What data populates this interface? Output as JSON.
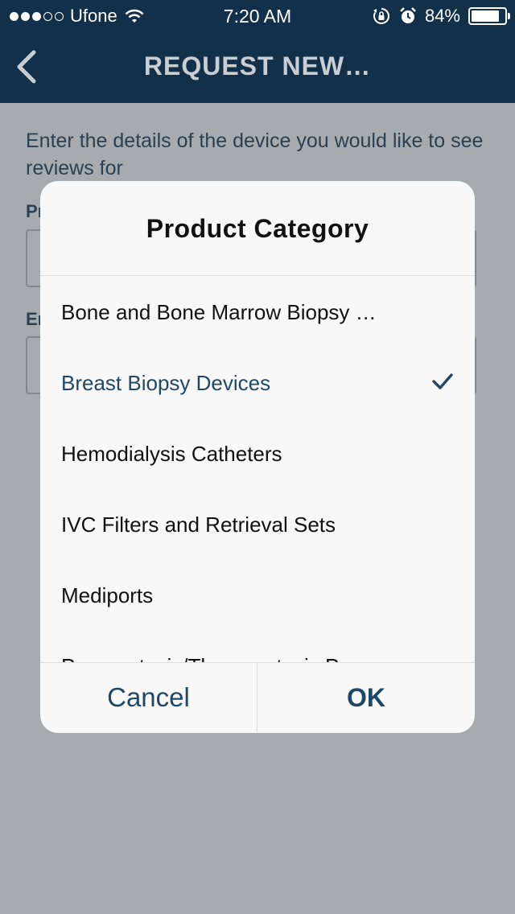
{
  "status_bar": {
    "carrier": "Ufone",
    "time": "7:20 AM",
    "battery": "84%",
    "battery_level": 0.84,
    "signal_bars": 3,
    "signal_total": 5,
    "icons": [
      "wifi-icon",
      "rotation-lock-icon",
      "alarm-icon",
      "battery-icon"
    ]
  },
  "navbar": {
    "title": "REQUEST NEW…",
    "back_icon": "chevron-left-icon"
  },
  "page": {
    "instructions": "Enter the details of the device you would like to see reviews for",
    "field1_label": "Pr",
    "field2_label": "Er"
  },
  "dialog": {
    "title": "Product Category",
    "items": [
      {
        "label": "Bone and Bone Marrow Biopsy …",
        "selected": false
      },
      {
        "label": "Breast Biopsy Devices",
        "selected": true
      },
      {
        "label": "Hemodialysis Catheters",
        "selected": false
      },
      {
        "label": "IVC Filters and Retrieval Sets",
        "selected": false
      },
      {
        "label": "Mediports",
        "selected": false
      },
      {
        "label": "Paracentesis/Thoracentesis Pro…",
        "selected": false
      }
    ],
    "cancel_label": "Cancel",
    "ok_label": "OK"
  },
  "colors": {
    "nav_background": "#13304b",
    "accent": "#1f4866",
    "overlay": "#9aa1a7"
  }
}
